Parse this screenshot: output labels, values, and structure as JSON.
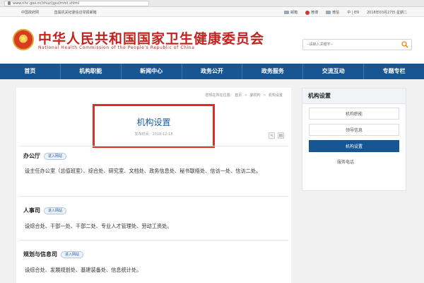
{
  "browser": {
    "url": "www.nhc.gov.cn/zhuz/jgsz/mmt.shtml"
  },
  "topbar": {
    "left_links": [
      "中国政府网",
      "直属机关纪委信访举报邮箱"
    ],
    "right_links": [
      "邮箱",
      "微博",
      "微信",
      "中 | EN",
      "2018年03月27日  星期二"
    ]
  },
  "header": {
    "title": "中华人民共和国国家卫生健康委员会",
    "subtitle": "National Health Commission of the People's Republic of China",
    "search_placeholder": "--请输入关键字--"
  },
  "nav": {
    "items": [
      "首页",
      "机构职能",
      "新闻中心",
      "政务公开",
      "政务服务",
      "交流互动",
      "专题专栏"
    ]
  },
  "main": {
    "breadcrumb": {
      "prefix": "您现在所在位置：",
      "items": [
        "首页",
        "委机构",
        "机构设置"
      ]
    },
    "title": "机构设置",
    "date_label": "发布时间：",
    "date": "2018-12-18",
    "sections": [
      {
        "name": "办公厅",
        "button": "进入网站",
        "text": "设主任办公室（总值班室）、综合处、研究室、文档处、政务信息处、秘书联络处、信访一处、信访二处。"
      },
      {
        "name": "人事司",
        "button": "进入网站",
        "text": "设综合处、干部一处、干部二处、专业人才管理处、劳动工资处。"
      },
      {
        "name": "规划与信息司",
        "button": "进入网站",
        "text": "设综合处、发展规划处、基建装备处、信息统计处。"
      }
    ]
  },
  "sidebar": {
    "heading": "机构设置",
    "items": [
      "机构职能",
      "领导信息",
      "机构设置",
      "服务电话"
    ],
    "active_index": 2
  },
  "colors": {
    "nav_blue": "#185593",
    "title_red": "#c3231c",
    "highlight_red": "#e42d22"
  }
}
